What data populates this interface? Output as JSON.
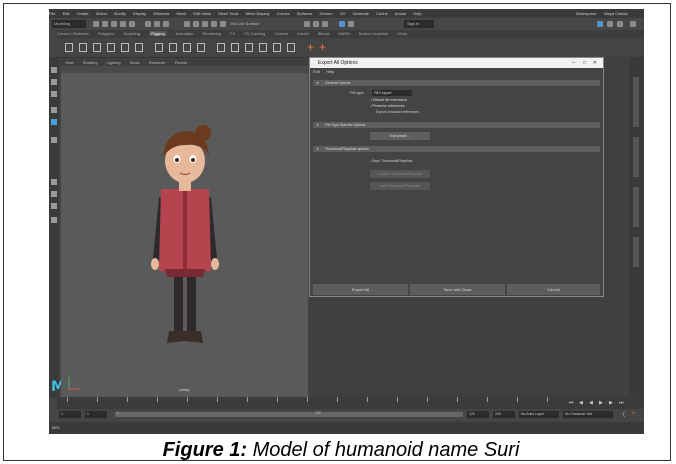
{
  "caption": {
    "prefix": "Figure 1:",
    "text": " Model of humanoid name Suri"
  },
  "maya": {
    "menu": [
      "File",
      "Edit",
      "Create",
      "Select",
      "Modify",
      "Display",
      "Windows",
      "Mesh",
      "Edit Mesh",
      "Mesh Tools",
      "Mesh Display",
      "Curves",
      "Surfaces",
      "Deform",
      "UV",
      "Generate",
      "Cache",
      "Arnold",
      "Help"
    ],
    "workspace_label": "Workspace:",
    "workspace_value": "Maya Classic",
    "mode": "Modeling",
    "no_live_surface": "No Live Surface",
    "sign_in": "Sign In",
    "shelf_tabs": [
      "Curves / Surfaces",
      "Polygons",
      "Sculpting",
      "Rigging",
      "Animation",
      "Rendering",
      "FX",
      "FX Caching",
      "Custom",
      "Arnold",
      "Bifrost",
      "MASH",
      "Motion Graphics",
      "XGen"
    ],
    "active_shelf_tab": "Rigging",
    "viewport_menu": [
      "View",
      "Shading",
      "Lighting",
      "Show",
      "Renderer",
      "Panels"
    ],
    "camera_label": "persp",
    "logo": "M",
    "range_start": "1",
    "range_inner_start": "1",
    "range_marker": "1",
    "range_inner_end": "120",
    "range_end": "120",
    "range_end2": "200",
    "anim_layer": "No Anim Layer",
    "char_set": "No Character Set",
    "mel_label": "MEL"
  },
  "dialog": {
    "title": "Export All Options",
    "menu": [
      "Edit",
      "Help"
    ],
    "section_general": "General Options",
    "file_type_label": "File type:",
    "file_type_value": "FBX export",
    "opt_default_refs": "Default file extensions",
    "opt_preserve_refs": "Preserve references",
    "opt_export_unloaded": "Export unloaded references",
    "section_file_specific": "File Type Specific Options",
    "edit_preset": "Edit preset ...",
    "section_thumb": "Thumbnail/Playblast options",
    "save_thumb": "Save Thumbnail/Playblast",
    "capture_thumb": "Capture Thumbnail/Playblast",
    "write_thumb": "Write Thumbnail/Playblast",
    "btn_export": "Export All",
    "btn_save_close": "Save and Close",
    "btn_cancel": "Cancel"
  },
  "colors": {
    "ui_dark": "#444444",
    "accent_blue": "#4aa0e0",
    "shirt": "#b5444f",
    "skin": "#e8b89a",
    "hair": "#6b3a1f"
  }
}
